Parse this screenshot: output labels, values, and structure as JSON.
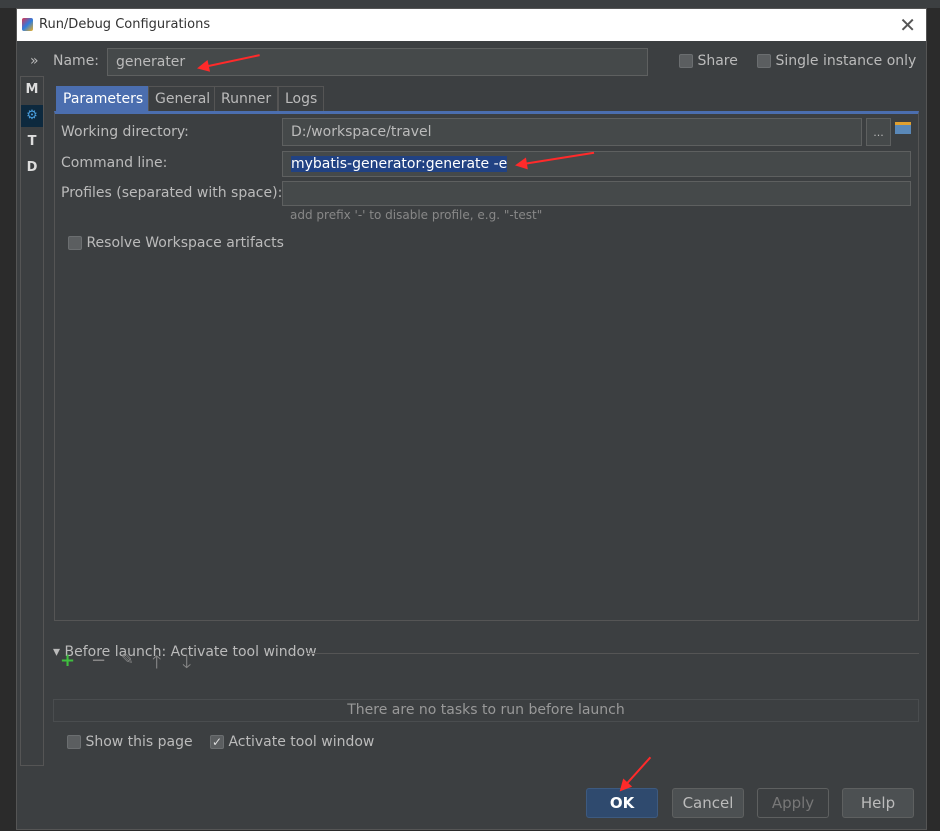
{
  "window": {
    "title": "Run/Debug Configurations",
    "close_icon": "close-icon"
  },
  "name": {
    "label": "Name:",
    "value": "generater"
  },
  "share": {
    "label": "Share",
    "checked": false
  },
  "single_instance": {
    "label": "Single instance only",
    "checked": false
  },
  "sidebar": {
    "toggle": "»",
    "items": [
      "M",
      "⚙",
      "T",
      "D"
    ]
  },
  "tabs": [
    {
      "label": "Parameters",
      "active": true
    },
    {
      "label": "General"
    },
    {
      "label": "Runner"
    },
    {
      "label": "Logs"
    }
  ],
  "params": {
    "working_dir_label": "Working directory:",
    "working_dir_value": "D:/workspace/travel",
    "browse_label": "...",
    "command_line_label": "Command line:",
    "command_line_value": "mybatis-generator:generate -e",
    "profiles_label": "Profiles (separated with space):",
    "profiles_value": "",
    "profiles_hint": "add prefix '-' to disable profile, e.g. \"-test\"",
    "resolve_label": "Resolve Workspace artifacts",
    "resolve_checked": false
  },
  "before_launch": {
    "title": "Before launch: Activate tool window",
    "empty_text": "There are no tasks to run before launch",
    "tools": [
      "add-icon",
      "remove-icon",
      "edit-icon",
      "move-up-icon",
      "move-down-icon"
    ]
  },
  "show_page": {
    "label": "Show this page",
    "checked": false
  },
  "activate_tool": {
    "label": "Activate tool window",
    "checked": true
  },
  "buttons": {
    "ok": "OK",
    "cancel": "Cancel",
    "apply": "Apply",
    "help": "Help"
  },
  "colors": {
    "accent": "#4b6eaf",
    "background": "#3c3f41",
    "annotation": "#ff2a2a",
    "add": "#3fbf3f"
  }
}
